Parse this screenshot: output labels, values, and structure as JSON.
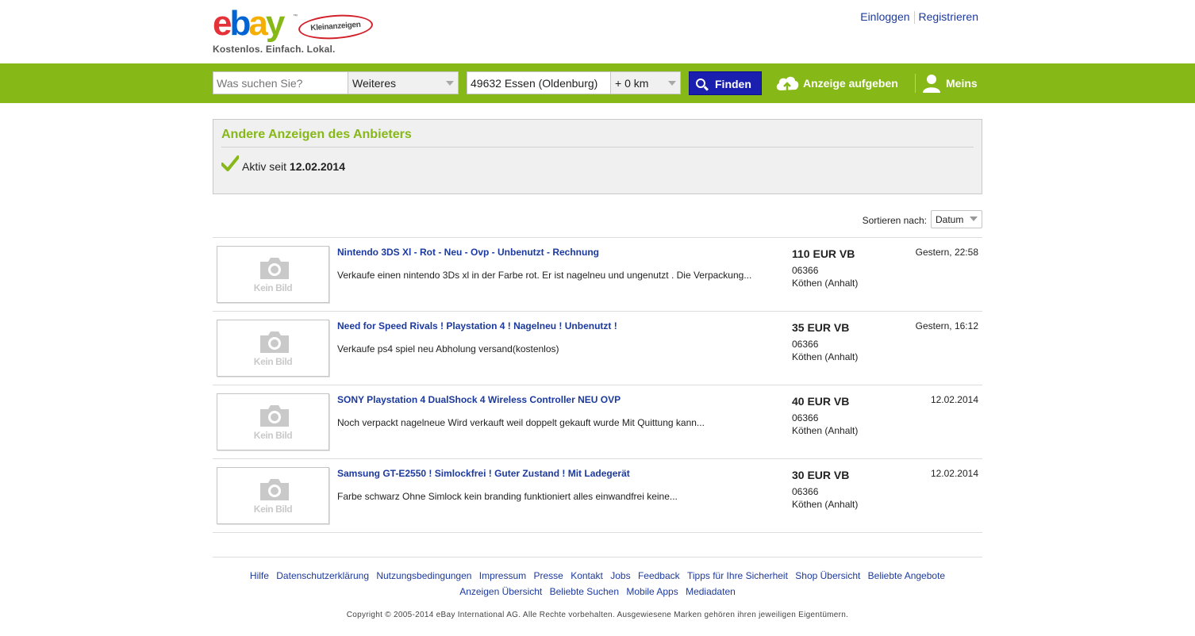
{
  "header": {
    "logo_text": "ebay",
    "logo_badge": "Kleinanzeigen",
    "logo_tm": "™",
    "slogan": "Kostenlos. Einfach. Lokal.",
    "login": "Einloggen",
    "register": "Registrieren"
  },
  "searchbar": {
    "search_placeholder": "Was suchen Sie?",
    "category": "Weiteres",
    "location": "49632 Essen (Oldenburg)",
    "radius": "+ 0 km",
    "find_button": "Finden",
    "post_ad": "Anzeige aufgeben",
    "meins": "Meins"
  },
  "seller": {
    "title": "Andere Anzeigen des Anbieters",
    "active_label": "Aktiv seit",
    "active_date": "12.02.2014"
  },
  "sort": {
    "label": "Sortieren nach:",
    "value": "Datum"
  },
  "listings": [
    {
      "title": "Nintendo 3DS Xl - Rot - Neu - Ovp - Unbenutzt - Rechnung",
      "description": "Verkaufe einen nintendo 3Ds xl in der Farbe rot. Er ist nagelneu und ungenutzt . Die Verpackung...",
      "price": "110 EUR VB",
      "zip": "06366",
      "city": "Köthen (Anhalt)",
      "date": "Gestern, 22:58",
      "image_placeholder": "Kein Bild"
    },
    {
      "title": "Need for Speed Rivals ! Playstation 4 ! Nagelneu ! Unbenutzt !",
      "description": "Verkaufe ps4 spiel neu Abholung versand(kostenlos)",
      "price": "35 EUR VB",
      "zip": "06366",
      "city": "Köthen (Anhalt)",
      "date": "Gestern, 16:12",
      "image_placeholder": "Kein Bild"
    },
    {
      "title": "SONY Playstation 4 DualShock 4 Wireless Controller NEU OVP",
      "description": "Noch verpackt nagelneue Wird verkauft weil doppelt gekauft wurde Mit Quittung kann...",
      "price": "40 EUR VB",
      "zip": "06366",
      "city": "Köthen (Anhalt)",
      "date": "12.02.2014",
      "image_placeholder": "Kein Bild"
    },
    {
      "title": "Samsung GT-E2550 ! Simlockfrei ! Guter Zustand ! Mit Ladegerät",
      "description": "Farbe schwarz Ohne Simlock kein branding funktioniert alles einwandfrei keine...",
      "price": "30 EUR VB",
      "zip": "06366",
      "city": "Köthen (Anhalt)",
      "date": "12.02.2014",
      "image_placeholder": "Kein Bild"
    }
  ],
  "footer": {
    "links_row1": [
      "Hilfe",
      "Datenschutzerklärung",
      "Nutzungsbedingungen",
      "Impressum",
      "Presse",
      "Kontakt",
      "Jobs",
      "Feedback",
      "Tipps für Ihre Sicherheit",
      "Shop Übersicht",
      "Beliebte Angebote"
    ],
    "links_row2": [
      "Anzeigen Übersicht",
      "Beliebte Suchen",
      "Mobile Apps",
      "Mediadaten"
    ],
    "copyright": "Copyright © 2005-2014 eBay International AG. Alle Rechte vorbehalten. Ausgewiesene Marken gehören ihren jeweiligen Eigentümern."
  },
  "colors": {
    "brand_green": "#86b817",
    "link_blue": "#1c3a9e",
    "button_blue": "#1a1fb0"
  },
  "icons": [
    "cloud-upload-icon",
    "user-icon",
    "search-icon",
    "checkmark-icon",
    "camera-icon",
    "chevron-down-icon"
  ]
}
